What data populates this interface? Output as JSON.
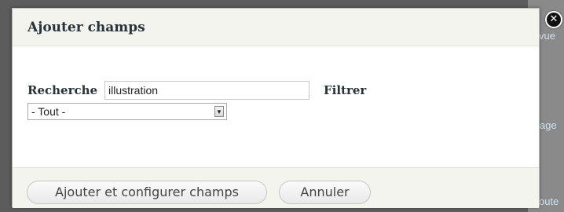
{
  "background": {
    "links": [
      "vue",
      "age",
      "oute"
    ]
  },
  "dialog": {
    "title": "Ajouter champs",
    "close_icon": "close-icon",
    "search": {
      "label": "Recherche",
      "value": "illustration"
    },
    "filter": {
      "label": "Filtrer",
      "selected": "- Tout -"
    },
    "buttons": {
      "add": "Ajouter et configurer champs",
      "cancel": "Annuler"
    }
  },
  "colors": {
    "backdrop": "#5c5c5c",
    "header_bg": "#f4f4ef",
    "title_text": "#27323a"
  }
}
